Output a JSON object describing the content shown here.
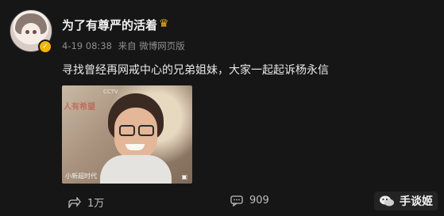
{
  "user": {
    "name": "为了有尊严的活着",
    "crown_icon": "crown-icon"
  },
  "meta": {
    "date": "4-19 08:38",
    "source": "来自 微博网页版"
  },
  "post": {
    "text": "寻找曾经再网戒中心的兄弟姐妹，大家一起起诉杨永信"
  },
  "media": {
    "caption": "小新超时代",
    "red_text": "人有希望"
  },
  "actions": {
    "share_count": "1万",
    "like_count": "909"
  },
  "watermark": {
    "label": "手谈姬"
  },
  "colors": {
    "background": "#161616",
    "badge": "#f6b400",
    "crown": "#f2b01e"
  }
}
